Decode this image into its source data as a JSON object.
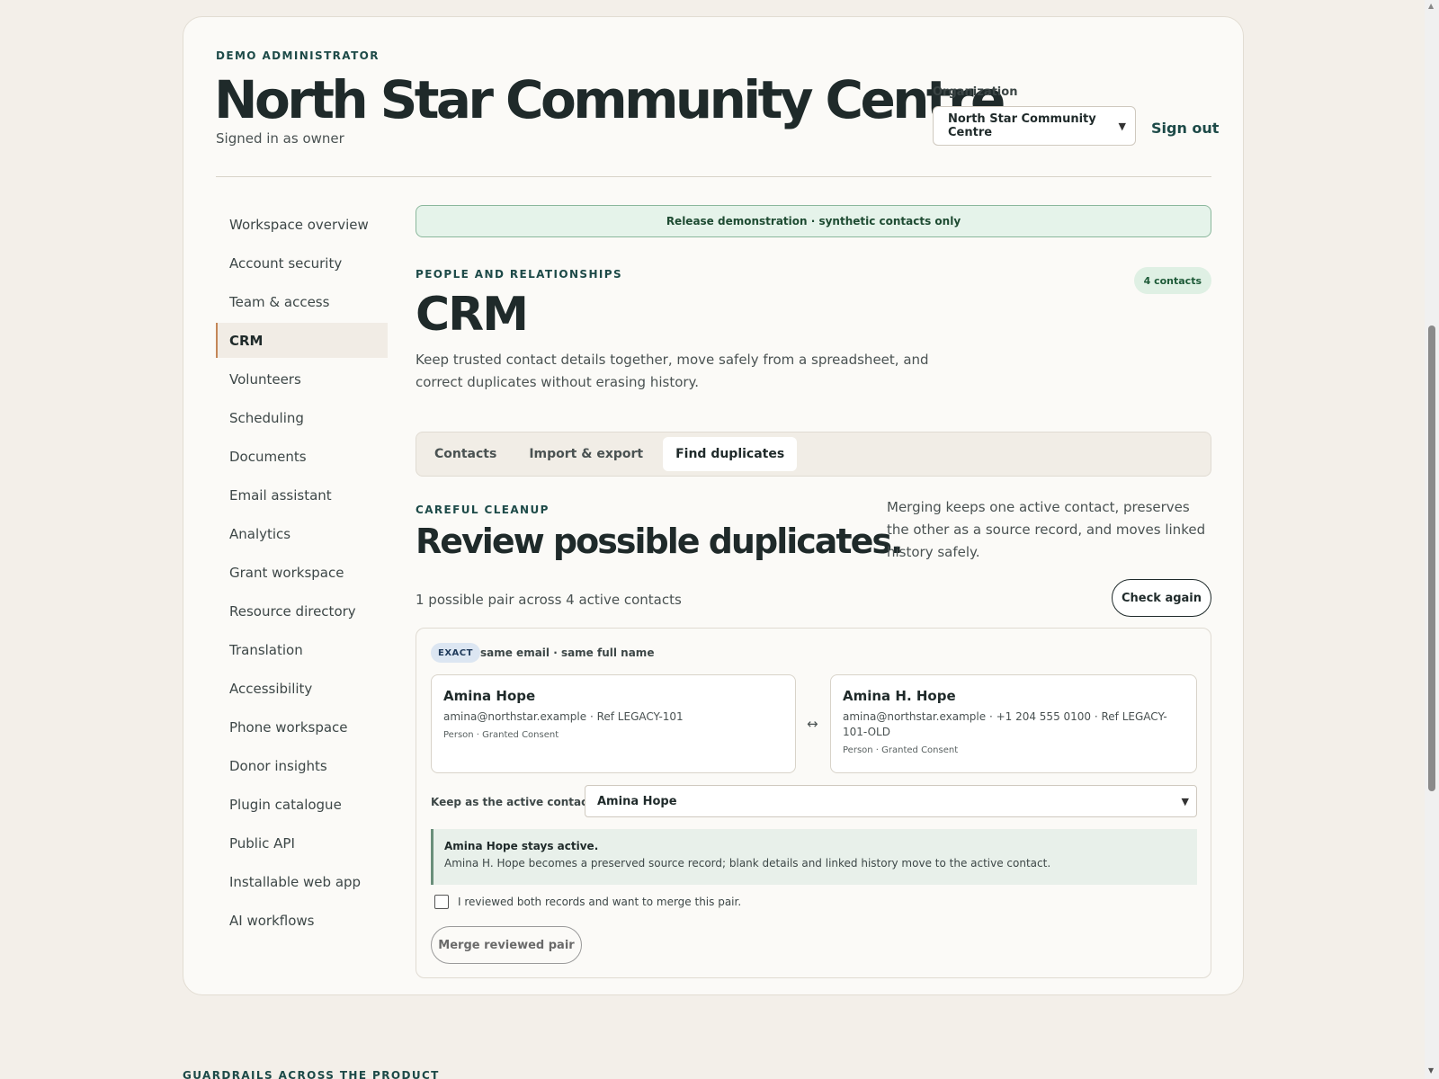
{
  "header": {
    "eyebrow": "DEMO ADMINISTRATOR",
    "title": "North Star Community Centre",
    "subtitle": "Signed in as owner",
    "org_label": "Organization",
    "org_selected": "North Star Community Centre",
    "sign_out": "Sign out"
  },
  "sidebar": {
    "items": [
      {
        "label": "Workspace overview"
      },
      {
        "label": "Account security"
      },
      {
        "label": "Team & access"
      },
      {
        "label": "CRM",
        "active": true
      },
      {
        "label": "Volunteers"
      },
      {
        "label": "Scheduling"
      },
      {
        "label": "Documents"
      },
      {
        "label": "Email assistant"
      },
      {
        "label": "Analytics"
      },
      {
        "label": "Grant workspace"
      },
      {
        "label": "Resource directory"
      },
      {
        "label": "Translation"
      },
      {
        "label": "Accessibility"
      },
      {
        "label": "Phone workspace"
      },
      {
        "label": "Donor insights"
      },
      {
        "label": "Plugin catalogue"
      },
      {
        "label": "Public API"
      },
      {
        "label": "Installable web app"
      },
      {
        "label": "AI workflows"
      }
    ]
  },
  "main": {
    "banner": "Release demonstration · synthetic contacts only",
    "eyebrow": "PEOPLE AND RELATIONSHIPS",
    "count": "4 contacts",
    "title": "CRM",
    "description": "Keep trusted contact details together, move safely from a spreadsheet, and correct duplicates without erasing history.",
    "tabs": [
      {
        "label": "Contacts"
      },
      {
        "label": "Import & export"
      },
      {
        "label": "Find duplicates",
        "active": true
      }
    ]
  },
  "cleanup": {
    "eyebrow": "CAREFUL CLEANUP",
    "title": "Review possible duplicates.",
    "note": "Merging keeps one active contact, preserves the other as a source record, and moves linked history safely.",
    "pair_count": "1 possible pair across 4 active contacts",
    "check_again": "Check again",
    "pair": {
      "badge": "EXACT",
      "reason": "same email · same full name",
      "left": {
        "name": "Amina Hope",
        "detail": "amina@northstar.example · Ref LEGACY-101",
        "meta": "Person · Granted Consent"
      },
      "right": {
        "name": "Amina H. Hope",
        "detail": "amina@northstar.example · +1 204 555 0100 · Ref LEGACY-101-OLD",
        "meta": "Person · Granted Consent"
      },
      "swap_glyph": "↔",
      "keep_label": "Keep as the active contact",
      "keep_selected": "Amina Hope",
      "summary_title": "Amina Hope stays active.",
      "summary_body": "Amina H. Hope becomes a preserved source record; blank details and linked history move to the active contact.",
      "confirm_label": "I reviewed both records and want to merge this pair.",
      "merge_button": "Merge reviewed pair"
    }
  },
  "footer": {
    "eyebrow": "GUARDRAILS ACROSS THE PRODUCT"
  }
}
